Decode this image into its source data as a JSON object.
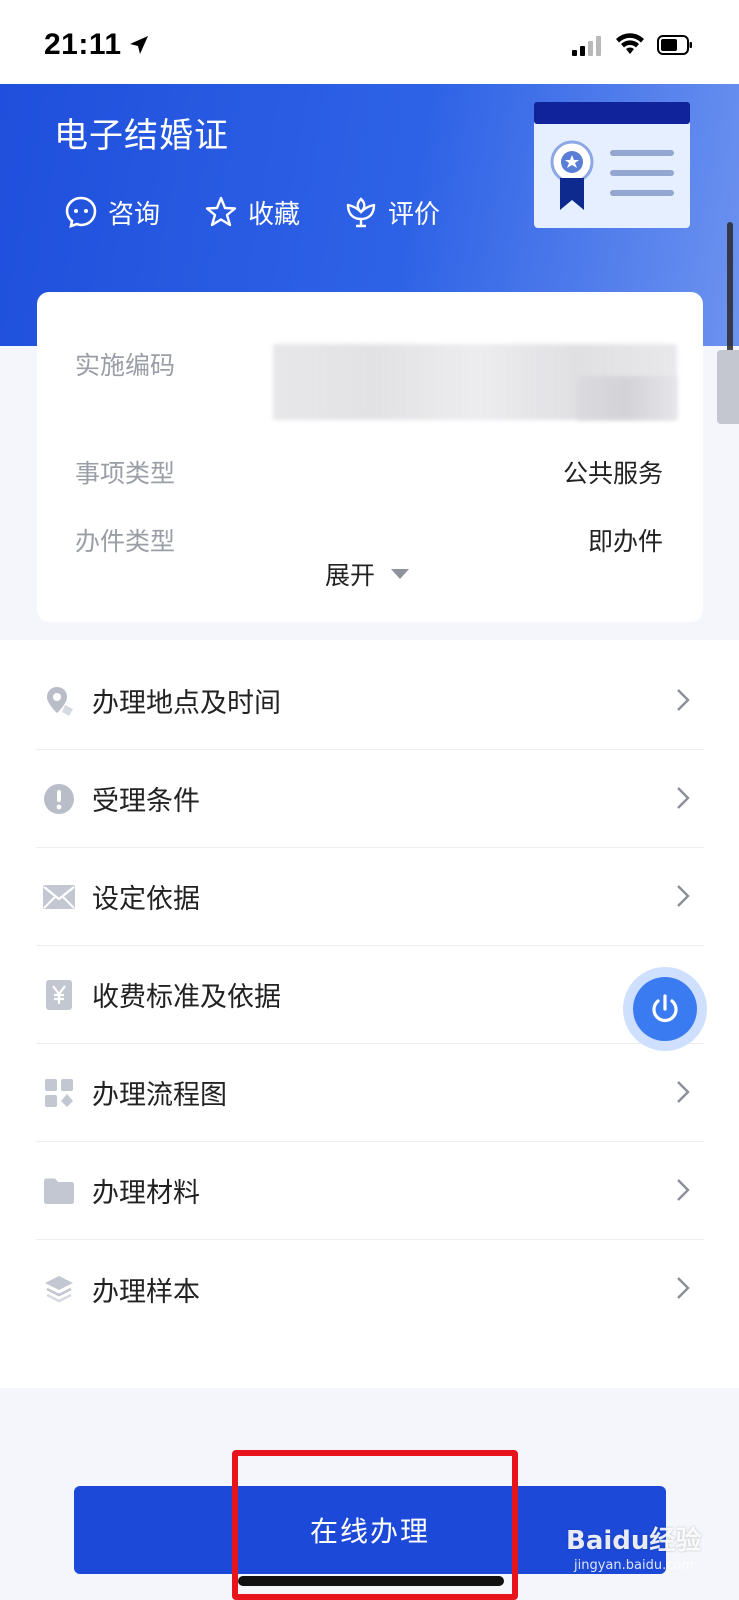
{
  "status_bar": {
    "time": "21:11"
  },
  "header": {
    "title": "电子结婚证",
    "actions": [
      {
        "label": "咨询",
        "icon": "chat-icon"
      },
      {
        "label": "收藏",
        "icon": "star-icon"
      },
      {
        "label": "评价",
        "icon": "flower-icon"
      }
    ]
  },
  "info": {
    "rows": [
      {
        "label": "实施编码",
        "value": ""
      },
      {
        "label": "事项类型",
        "value": "公共服务"
      },
      {
        "label": "办件类型",
        "value": "即办件"
      }
    ],
    "expand_label": "展开"
  },
  "menu": {
    "items": [
      {
        "label": "办理地点及时间",
        "icon": "location-icon"
      },
      {
        "label": "受理条件",
        "icon": "exclamation-icon"
      },
      {
        "label": "设定依据",
        "icon": "envelope-icon"
      },
      {
        "label": "收费标准及依据",
        "icon": "yen-icon"
      },
      {
        "label": "办理流程图",
        "icon": "grid-icon"
      },
      {
        "label": "办理材料",
        "icon": "folder-icon"
      },
      {
        "label": "办理样本",
        "icon": "layers-icon"
      }
    ]
  },
  "footer": {
    "online_button": "在线办理"
  },
  "watermark": {
    "brand": "Baidu经验",
    "url": "jingyan.baidu.com"
  },
  "colors": {
    "primary": "#1c49d8",
    "header_blue": "#2458e0",
    "highlight_red": "#e8141c"
  }
}
